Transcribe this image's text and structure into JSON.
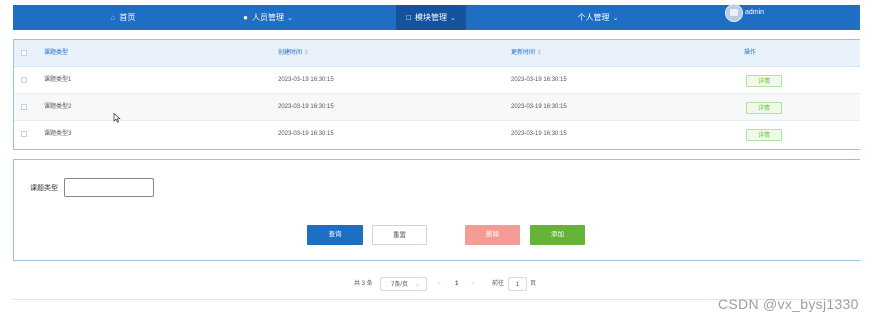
{
  "nav": {
    "home": "首页",
    "personnel": "人员管理",
    "module": "模块管理",
    "personal": "个人管理",
    "user": "admin"
  },
  "table": {
    "headers": {
      "type": "课题类型",
      "created": "创建时间",
      "updated": "更新时间",
      "actions": "操作"
    },
    "sort_mark": "⇕",
    "rows": [
      {
        "type": "课题类型1",
        "created": "2023-03-19 16:30:15",
        "updated": "2023-03-19 16:30:15",
        "action": "详情"
      },
      {
        "type": "课题类型2",
        "created": "2023-03-19 16:30:15",
        "updated": "2023-03-19 16:30:15",
        "action": "详情"
      },
      {
        "type": "课题类型3",
        "created": "2023-03-19 16:30:15",
        "updated": "2023-03-19 16:30:15",
        "action": "详情"
      }
    ]
  },
  "form": {
    "label": "课题类型",
    "value": "",
    "query": "查询",
    "reset": "重置",
    "delete": "删除",
    "add": "添加"
  },
  "pagination": {
    "total": "共 3 条",
    "page_size": "7条/页",
    "current_page": "1",
    "goto_prefix": "前往",
    "goto_value": "1",
    "goto_suffix": "页"
  },
  "watermark": "CSDN @vx_bysj1330",
  "colors": {
    "primary": "#1e6ec4",
    "success": "#67b33a",
    "danger": "#f59b95"
  },
  "icons": [
    "home-icon",
    "user-icon",
    "module-icon",
    "chevron-down-icon",
    "avatar-image-icon",
    "mouse-cursor-icon"
  ]
}
